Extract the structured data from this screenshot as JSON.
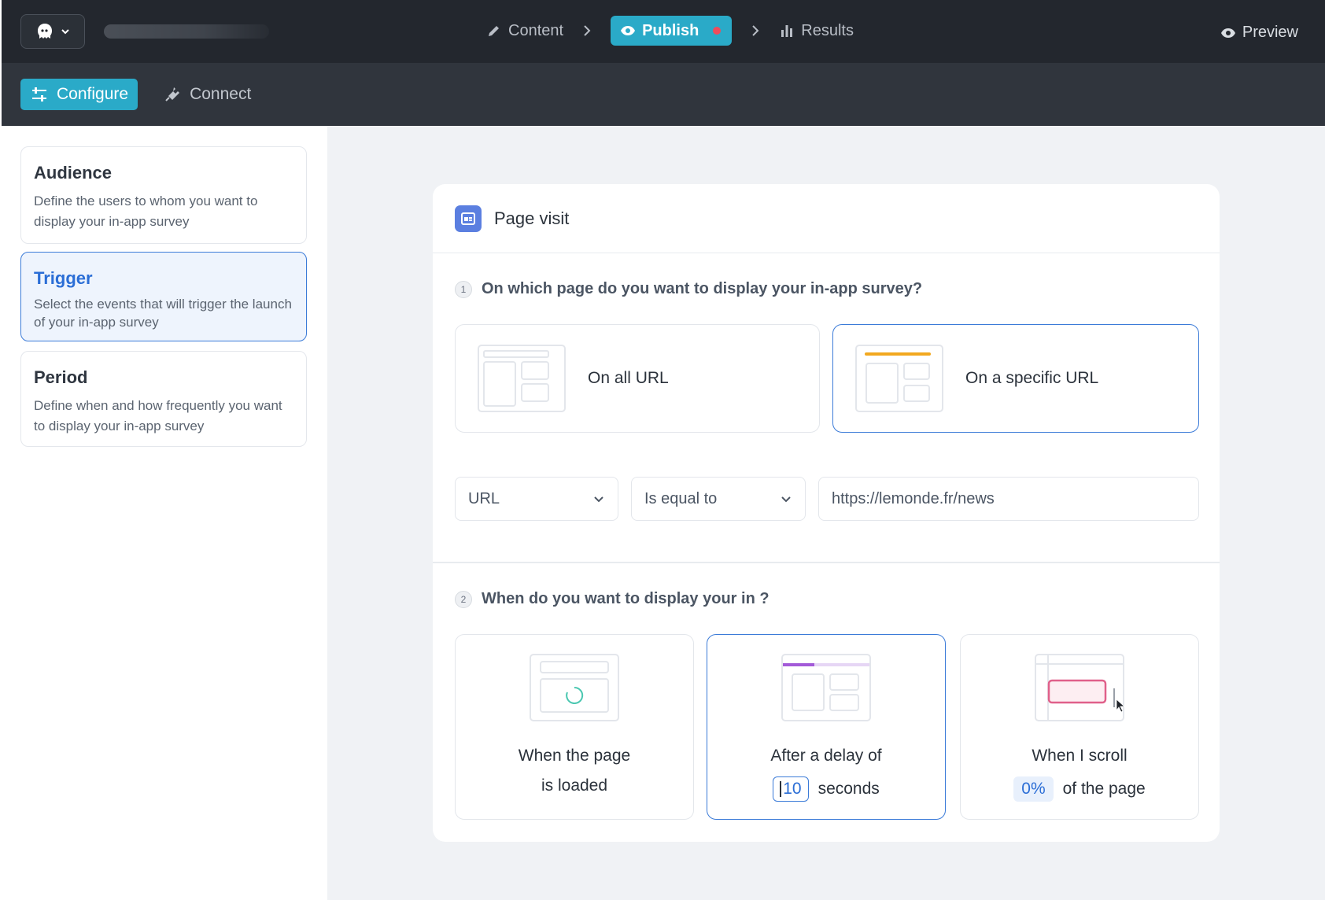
{
  "header": {
    "steps": [
      {
        "label": "Content",
        "icon": "pencil-icon"
      },
      {
        "label": "Publish",
        "icon": "eye-icon",
        "active": true
      },
      {
        "label": "Results",
        "icon": "bar-chart-icon"
      }
    ],
    "preview_label": "Preview"
  },
  "subnav": {
    "tabs": [
      {
        "label": "Configure",
        "icon": "sliders-icon",
        "active": true
      },
      {
        "label": "Connect",
        "icon": "plug-icon"
      }
    ]
  },
  "sidebar": {
    "items": [
      {
        "title": "Audience",
        "description": "Define the users to whom you want to display your in-app survey"
      },
      {
        "title": "Trigger",
        "description": "Select the events that will trigger the launch of your in-app survey",
        "active": true
      },
      {
        "title": "Period",
        "description": "Define when and how frequently you want to display your in-app survey"
      }
    ]
  },
  "panel": {
    "title": "Page visit",
    "q1": {
      "number": "1",
      "text": "On which page do you want to display your in-app survey?"
    },
    "url_options": [
      {
        "label": "On all URL"
      },
      {
        "label": "On a specific URL",
        "selected": true
      }
    ],
    "filter": {
      "field": "URL",
      "operator": "Is equal to",
      "value": "https://lemonde.fr/news"
    },
    "q2": {
      "number": "2",
      "text": "When do you want to display your in ?"
    },
    "timing": {
      "loaded": {
        "line1": "When the page",
        "line2": "is loaded"
      },
      "delay": {
        "line1": "After a delay of",
        "value": "10",
        "unit": "seconds",
        "selected": true
      },
      "scroll": {
        "line1": "When I scroll",
        "value": "0%",
        "suffix": "of the page"
      }
    }
  },
  "colors": {
    "accent": "#2aaac8",
    "selected_border": "#3b7bd8",
    "notification_dot": "#ef4c5c"
  }
}
